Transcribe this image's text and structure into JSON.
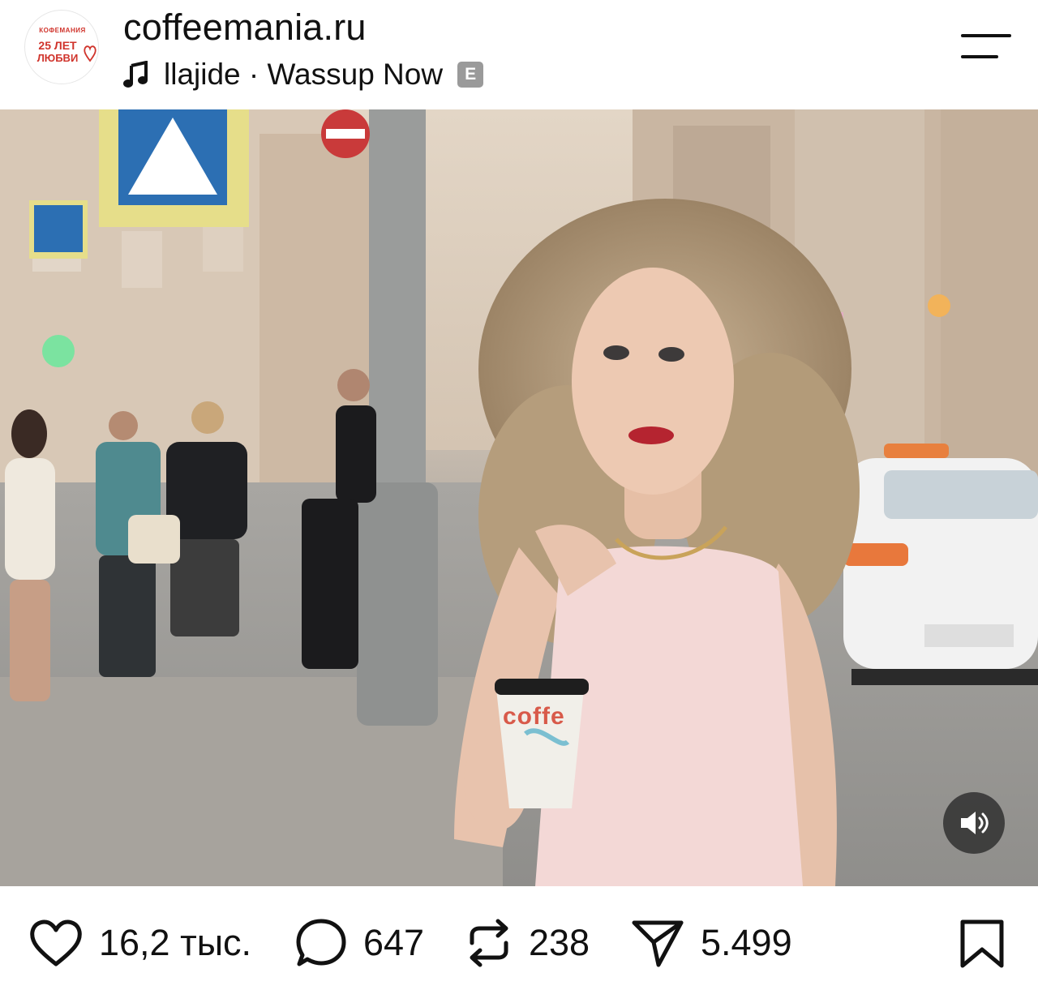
{
  "header": {
    "avatar": {
      "brand": "КОФЕМАНИЯ",
      "years": "25 ЛЕТ",
      "love": "ЛЮБВИ"
    },
    "username": "coffeemania.ru",
    "music": {
      "icon": "music-note-icon",
      "track": "llajide · Wassup Now",
      "explicit_badge": "E"
    },
    "menu_icon": "menu-icon"
  },
  "media": {
    "type": "video",
    "cup_text": "coffe",
    "sound_icon": "speaker-icon"
  },
  "actions": {
    "likes": "16,2 тыс.",
    "comments": "647",
    "reposts": "238",
    "shares": "5.499",
    "icons": [
      "heart-icon",
      "comment-icon",
      "repost-icon",
      "send-icon",
      "bookmark-icon"
    ]
  },
  "colors": {
    "brand_red": "#d0342c",
    "text": "#111111",
    "overlay_button": "#2a2a2a"
  }
}
